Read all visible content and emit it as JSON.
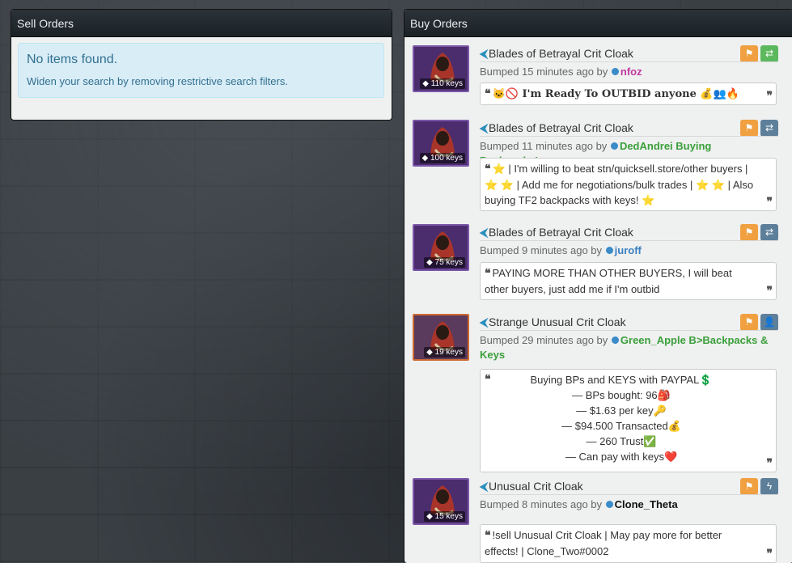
{
  "sell_orders": {
    "heading": "Sell Orders",
    "empty_title": "No items found.",
    "empty_hint": "Widen your search by removing restrictive search filters."
  },
  "buy_orders": {
    "heading": "Buy Orders",
    "listings": [
      {
        "item": "Blades of Betrayal Crit Cloak",
        "price": "110 keys",
        "bumped": "Bumped 15 minutes ago by",
        "user": "nfoz",
        "user_color": "#c0399f",
        "note_lines": [
          "🐱🚫 I'm Ready To OUTBID anyone 💰👥🔥"
        ]
      },
      {
        "item": "Blades of Betrayal Crit Cloak",
        "price": "100 keys",
        "bumped": "Bumped 11 minutes ago by",
        "user": "DedAndrei Buying Backpacks!",
        "user_color": "#3a9f3a",
        "note_lines": [
          "⭐ | I'm willing to beat stn/quicksell.store/other buyers | ⭐ ⭐ | Add me for negotiations/bulk trades | ⭐ ⭐ | Also buying TF2 backpacks with keys! ⭐"
        ]
      },
      {
        "item": "Blades of Betrayal Crit Cloak",
        "price": "75 keys",
        "bumped": "Bumped 9 minutes ago by",
        "user": "juroff",
        "user_color": "#3a7fc0",
        "note_lines": [
          "PAYING MORE THAN OTHER BUYERS, I will beat other buyers, just add me if I'm outbid"
        ]
      },
      {
        "item": "Strange Unusual Crit Cloak",
        "price": "19 keys",
        "bumped": "Bumped 29 minutes ago by",
        "user": "Green_Apple B>Backpacks & Keys",
        "user_color": "#3a9f3a",
        "note_lines": [
          "Buying BPs and KEYS with PAYPAL💲",
          "— BPs bought: 96🎒",
          "— $1.63 per key🔑",
          "— $94.500 Transacted💰",
          "— 260 Trust✅",
          "— Can pay with keys❤️"
        ]
      },
      {
        "item": "Unusual Crit Cloak",
        "price": "15 keys",
        "bumped": "Bumped 8 minutes ago by",
        "user": "Clone_Theta",
        "user_color": "#111111",
        "note_lines": [
          "!sell Unusual Crit Cloak | May pay more for better effects! | Clone_Two#0002"
        ]
      }
    ]
  },
  "icons": {
    "flag": "flag-icon",
    "exchange": "exchange-icon",
    "add_friend": "add-friend-icon",
    "lightning": "lightning-icon",
    "quote": "quote-icon",
    "back_arrow": "arrow-left-icon",
    "tag": "tag-icon"
  },
  "colors": {
    "flag_button": "#f0a040",
    "trade_button_green": "#5cb85c",
    "trade_button_steel": "#5d7f9a",
    "strange_border": "#cf6a32",
    "unique_border": "#7b57a8"
  }
}
